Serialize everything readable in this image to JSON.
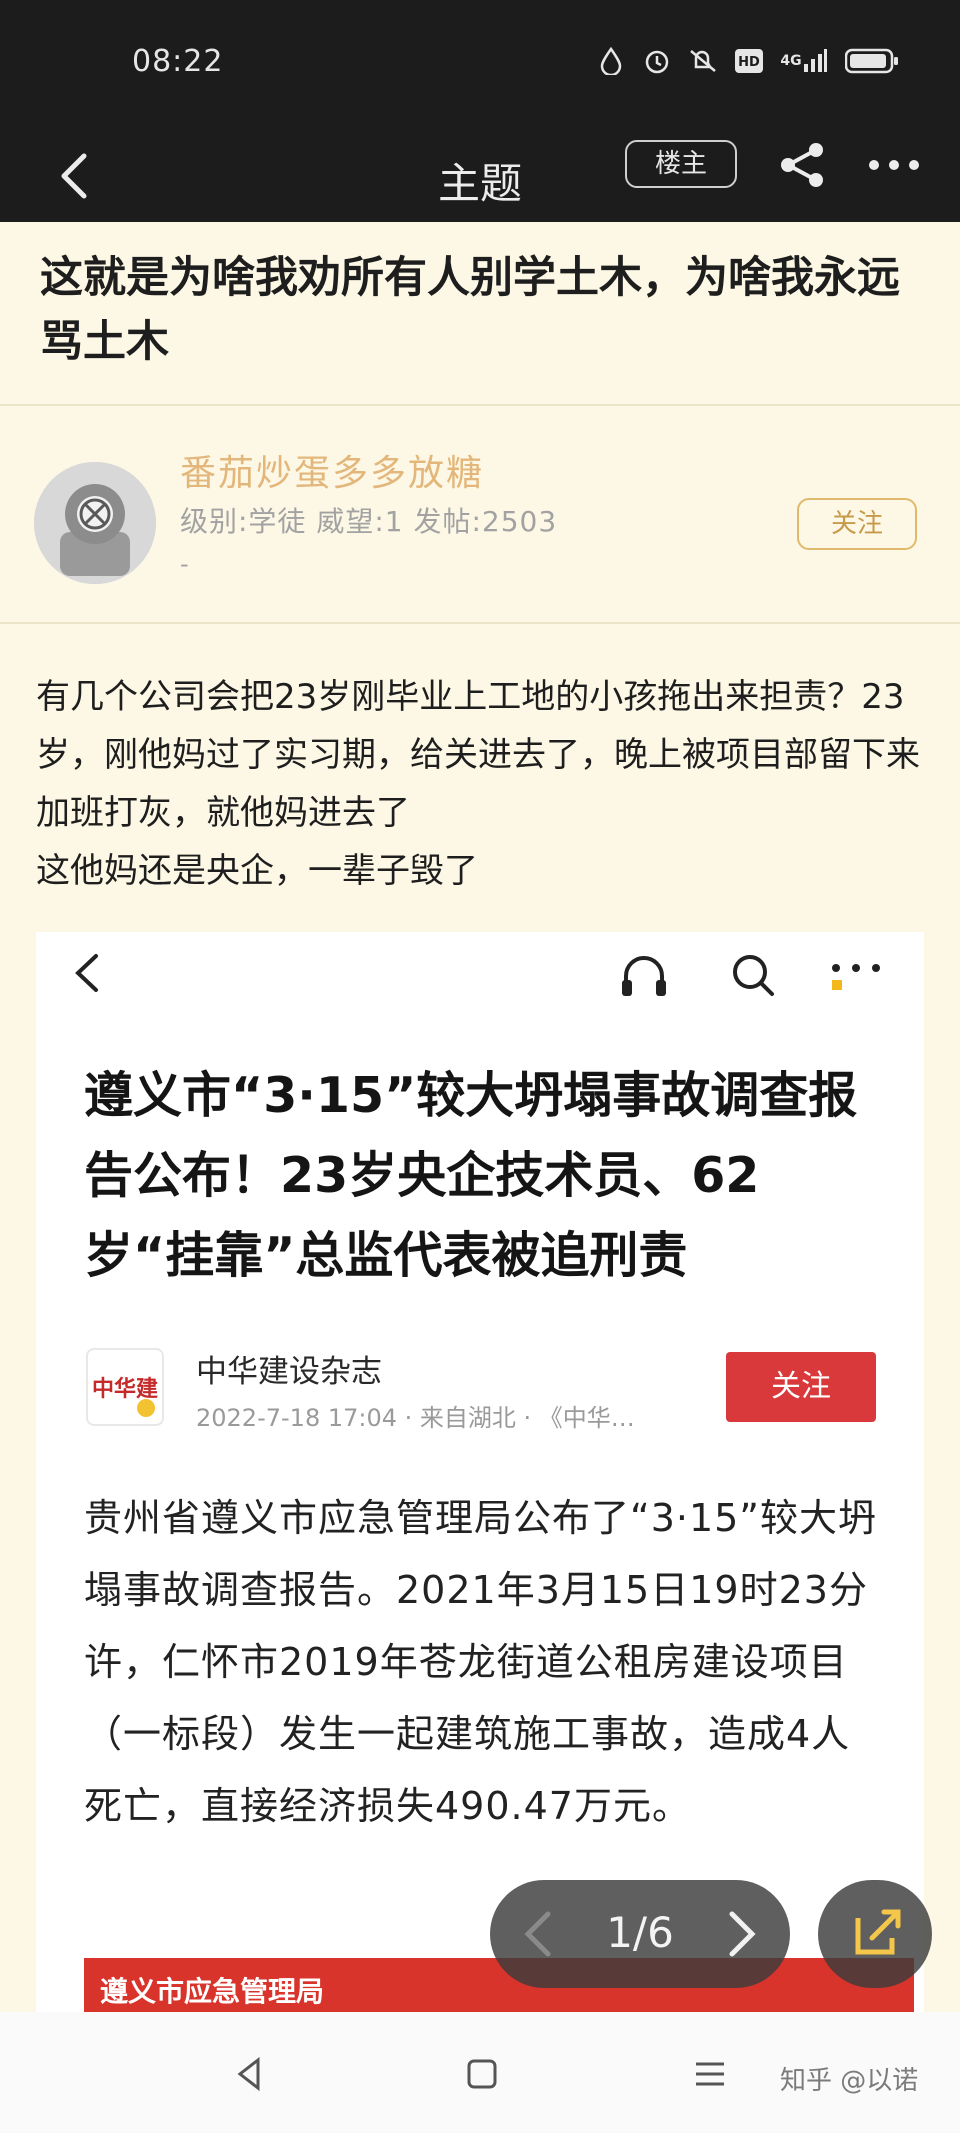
{
  "status_bar": {
    "time": "08:22",
    "network": "4G",
    "hd_label": "HD"
  },
  "nav": {
    "title": "主题",
    "owner_label": "楼主"
  },
  "post": {
    "title": "这就是为啥我劝所有人别学土木，为啥我永远骂土木",
    "author": {
      "name": "番茄炒蛋多多放糖",
      "meta": "级别:学徒 威望:1 发帖:2503",
      "extra": "-",
      "follow_label": "关注"
    },
    "body": [
      "有几个公司会把23岁刚毕业上工地的小孩拖出来担责？23岁，刚他妈过了实习期，给关进去了，晚上被项目部留下来加班打灰，就他妈进去了",
      "这他妈还是央企，一辈子毁了"
    ]
  },
  "embedded": {
    "headline": "遵义市“3·15”较大坍塌事故调查报告公布！23岁央企技术员、62岁“挂靠”总监代表被追刑责",
    "logo_text": "中华建",
    "source": "中华建设杂志",
    "date": "2022-7-18 17:04 · 来自湖北 · 《中华…",
    "follow_label": "关注",
    "paragraph": "贵州省遵义市应急管理局公布了“3·15”较大坍塌事故调查报告。2021年3月15日19时23分许，仁怀市2019年苍龙街道公租房建设项目（一标段）发生一起建筑施工事故，造成4人死亡，直接经济损失490.47万元。",
    "banner_text": "遵义市应急管理局"
  },
  "pager": {
    "label": "1/6"
  },
  "watermark": "知乎 @以诺",
  "colors": {
    "page_bg": "#fdf8e6",
    "author_name": "#e3b77b",
    "follow_red": "#d9393a",
    "bar_dark": "#1c1c1c"
  }
}
